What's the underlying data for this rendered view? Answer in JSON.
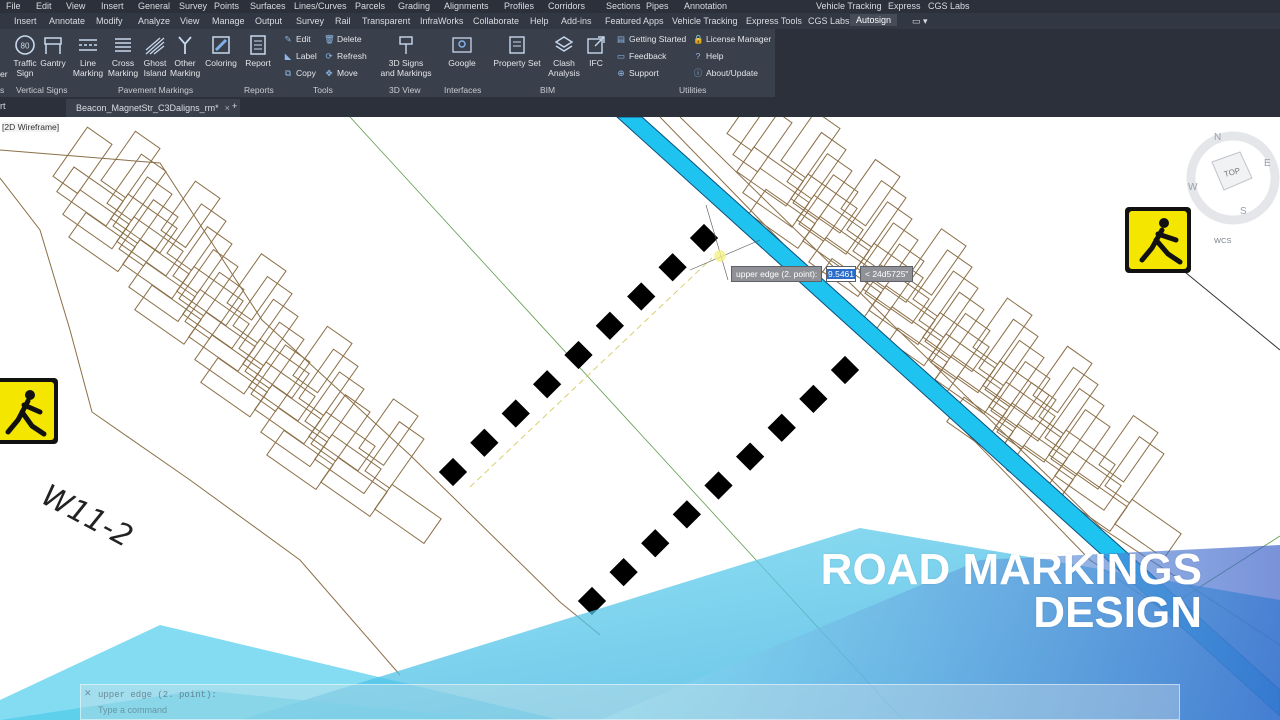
{
  "menu": [
    "File",
    "Edit",
    "View",
    "Insert",
    "General",
    "Survey",
    "Points",
    "Surfaces",
    "Lines/Curves",
    "Parcels",
    "Grading",
    "Alignments",
    "Profiles",
    "Corridors",
    "Sections",
    "Pipes",
    "Annotation",
    "Vehicle Tracking",
    "Express",
    "CGS Labs"
  ],
  "tabs": [
    "Insert",
    "Annotate",
    "Modify",
    "Analyze",
    "View",
    "Manage",
    "Output",
    "Survey",
    "Rail",
    "Transparent",
    "InfraWorks",
    "Collaborate",
    "Help",
    "Add-ins",
    "Featured Apps",
    "Vehicle Tracking",
    "Express Tools",
    "CGS Labs",
    "Autosign"
  ],
  "active_tab": "Autosign",
  "ribbon": {
    "buttons": {
      "traffic_sign": "Traffic\nSign",
      "gantry": "Gantry",
      "line_marking": "Line\nMarking",
      "cross_marking": "Cross\nMarking",
      "ghost_island": "Ghost\nIsland",
      "other_marking": "Other\nMarking",
      "coloring": "Coloring",
      "report": "Report",
      "signs3d": "3D Signs\nand Markings",
      "google": "Google",
      "property_set": "Property Set",
      "clash_analysis": "Clash\nAnalysis",
      "ifc": "IFC"
    },
    "tools": {
      "edit": "Edit",
      "delete": "Delete",
      "label": "Label",
      "refresh": "Refresh",
      "copy": "Copy",
      "move": "Move"
    },
    "utilities": {
      "getting_started": "Getting Started",
      "license_manager": "License Manager",
      "feedback": "Feedback",
      "help": "Help",
      "support": "Support",
      "about": "About/Update"
    },
    "panels": {
      "vertical_signs": "Vertical Signs",
      "pavement_markings": "Pavement Markings",
      "reports": "Reports",
      "tools": "Tools",
      "view3d": "3D View",
      "interfaces": "Interfaces",
      "bim": "BIM",
      "utilities": "Utilities"
    },
    "partial": {
      "left_top": "er",
      "left_panel": "s"
    },
    "traffic_sign_icon_text": "80"
  },
  "document": {
    "prev_tab_fragment": "rt",
    "tab": "Beacon_MagnetStr_C3Daligns_rm*",
    "add": "+"
  },
  "viewport_label": "[2D Wireframe]",
  "tooltip": {
    "prompt": "upper edge (2. point):",
    "value": "9.5461",
    "angle": "< 24d5725\""
  },
  "viewcube": {
    "top": "TOP",
    "n": "N",
    "e": "E",
    "s": "S",
    "w": "W",
    "wcs": "WCS"
  },
  "sign_label": "W11-2",
  "title_overlay": {
    "line1": "ROAD MARKINGS",
    "line2": "DESIGN"
  },
  "command_line": {
    "history": "upper edge (2. point):",
    "input_placeholder": "Type a command"
  },
  "colors": {
    "ribbon_bg": "#3a404b",
    "menubar_bg": "#2b303a",
    "cyan_line": "#1fc3f0",
    "sign_yellow": "#f5e600",
    "marking_black": "#000000",
    "grid_brown": "#8b6f47"
  }
}
